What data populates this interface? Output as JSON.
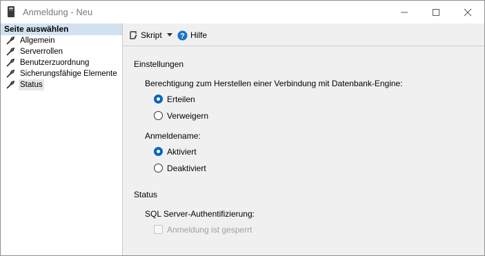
{
  "window": {
    "title": "Anmeldung - Neu"
  },
  "sidebar": {
    "header": "Seite auswählen",
    "items": [
      {
        "label": "Allgemein"
      },
      {
        "label": "Serverrollen"
      },
      {
        "label": "Benutzerzuordnung"
      },
      {
        "label": "Sicherungsfähige Elemente"
      },
      {
        "label": "Status",
        "selected": true
      }
    ]
  },
  "toolbar": {
    "script_label": "Skript",
    "help_label": "Hilfe"
  },
  "main": {
    "settings_heading": "Einstellungen",
    "permission_label": "Berechtigung zum Herstellen einer Verbindung mit Datenbank-Engine:",
    "permission_options": [
      {
        "label": "Erteilen",
        "selected": true
      },
      {
        "label": "Verweigern",
        "selected": false
      }
    ],
    "login_label": "Anmeldename:",
    "login_options": [
      {
        "label": "Aktiviert",
        "selected": true
      },
      {
        "label": "Deaktiviert",
        "selected": false
      }
    ],
    "status_heading": "Status",
    "auth_label": "SQL Server-Authentifizierung:",
    "locked_label": "Anmeldung ist gesperrt",
    "locked_checked": false,
    "locked_enabled": false
  },
  "colors": {
    "accent": "#0067c0",
    "sidebar_header_bg": "#d2e1f0"
  }
}
